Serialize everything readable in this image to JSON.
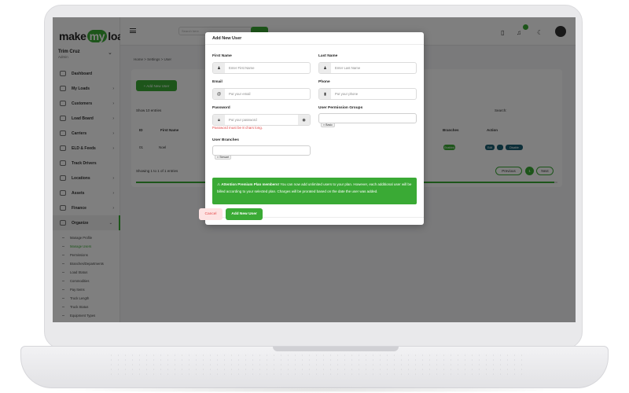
{
  "app": {
    "logo_text_a": "make",
    "logo_text_b": "my",
    "logo_text_c": "load"
  },
  "user": {
    "name": "Trim Cruz",
    "role": "Admin"
  },
  "sidebar": {
    "items": [
      {
        "label": "Dashboard"
      },
      {
        "label": "My Loads"
      },
      {
        "label": "Customers"
      },
      {
        "label": "Load Board"
      },
      {
        "label": "Carriers"
      },
      {
        "label": "ELD & Feeds"
      },
      {
        "label": "Track Drivers"
      },
      {
        "label": "Locations"
      },
      {
        "label": "Assets"
      },
      {
        "label": "Finance"
      },
      {
        "label": "Organize"
      }
    ],
    "sub_items": [
      {
        "label": "Manage Profile"
      },
      {
        "label": "Manage Users"
      },
      {
        "label": "Permissions"
      },
      {
        "label": "Branches/Departments"
      },
      {
        "label": "Load Status"
      },
      {
        "label": "Commodities"
      },
      {
        "label": "Pay Items"
      },
      {
        "label": "Truck Length"
      },
      {
        "label": "Truck Status"
      },
      {
        "label": "Equipment Types"
      }
    ]
  },
  "topbar": {
    "search_placeholder": "Search here"
  },
  "background": {
    "breadcrumb": "Home > Settings > User",
    "add_button": "+ Add New User",
    "show_entries": "Show 10 entries",
    "search_label": "Search:",
    "col_id": "ID",
    "col_first_name": "First Name",
    "col_branches": "Branches",
    "col_action": "Action",
    "row_id": "01",
    "row_name": "Noel",
    "row_status": "Enabled",
    "row_action_edit": "Edit",
    "row_action_disable": "Disable",
    "showing": "Showing 1 to 1 of 1 entries",
    "prev": "Previous",
    "page": "1",
    "next": "Next"
  },
  "modal": {
    "title": "Add New User",
    "first_name": {
      "label": "First Name",
      "placeholder": "Enter First Name"
    },
    "last_name": {
      "label": "Last Name",
      "placeholder": "Enter Last Name"
    },
    "email": {
      "label": "Email",
      "placeholder": "Put your email"
    },
    "phone": {
      "label": "Phone",
      "placeholder": "Put your phone"
    },
    "password": {
      "label": "Password",
      "placeholder": "Put your password",
      "error": "Password must be 8 chars long."
    },
    "permission_groups": {
      "label": "User Permission Groups",
      "tag": "× Basic"
    },
    "branches": {
      "label": "User Branches",
      "tag": "× Stewart"
    },
    "alert": {
      "bold": "Attention Premium Plan members!",
      "text": " You can now add unlimited users to your plan. However, each additional user will be billed according to your selected plan. Charges will be prorated based on the date the user was added."
    },
    "cancel": "Cancel",
    "submit": "Add New User"
  },
  "colors": {
    "accent": "#3aaa35",
    "error": "#e34848"
  },
  "icons": [
    "user-icon",
    "at-icon",
    "phone-icon",
    "lock-icon",
    "eye-icon",
    "bell-icon",
    "document-icon",
    "moon-icon",
    "warning-icon"
  ]
}
